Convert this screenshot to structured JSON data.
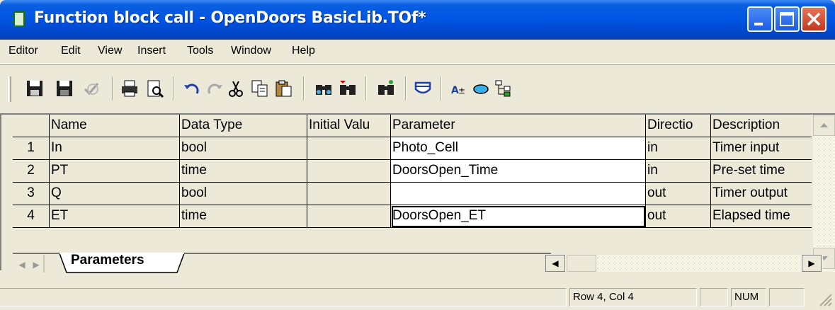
{
  "window": {
    "title": "Function block call - OpenDoors BasicLib.TOf*"
  },
  "menu": [
    "Editor",
    "Edit",
    "View",
    "Insert",
    "Tools",
    "Window",
    "Help"
  ],
  "toolbar_icons": [
    "save-icon",
    "save-all-icon",
    "check-icon",
    "print-icon",
    "print-preview-icon",
    "undo-icon",
    "redo-icon",
    "cut-icon",
    "copy-icon",
    "paste-icon",
    "find-icon",
    "find-next-icon",
    "replace-icon",
    "insert-block-icon",
    "text-size-icon",
    "ellipse-icon",
    "tree-icon"
  ],
  "grid": {
    "headers": [
      "",
      "Name",
      "Data Type",
      "Initial Valu",
      "Parameter",
      "Directio",
      "Description"
    ],
    "rows": [
      {
        "num": "1",
        "name": "In",
        "type": "bool",
        "init": "",
        "param": "Photo_Cell",
        "dir": "in",
        "desc": "Timer input"
      },
      {
        "num": "2",
        "name": "PT",
        "type": "time",
        "init": "",
        "param": "DoorsOpen_Time",
        "dir": "in",
        "desc": "Pre-set time"
      },
      {
        "num": "3",
        "name": "Q",
        "type": "bool",
        "init": "",
        "param": "",
        "dir": "out",
        "desc": "Timer output"
      },
      {
        "num": "4",
        "name": "ET",
        "type": "time",
        "init": "",
        "param": "DoorsOpen_ET",
        "dir": "out",
        "desc": "Elapsed time"
      }
    ]
  },
  "sheet_tab": "Parameters",
  "status": {
    "position": "Row 4, Col 4",
    "num": "NUM"
  }
}
